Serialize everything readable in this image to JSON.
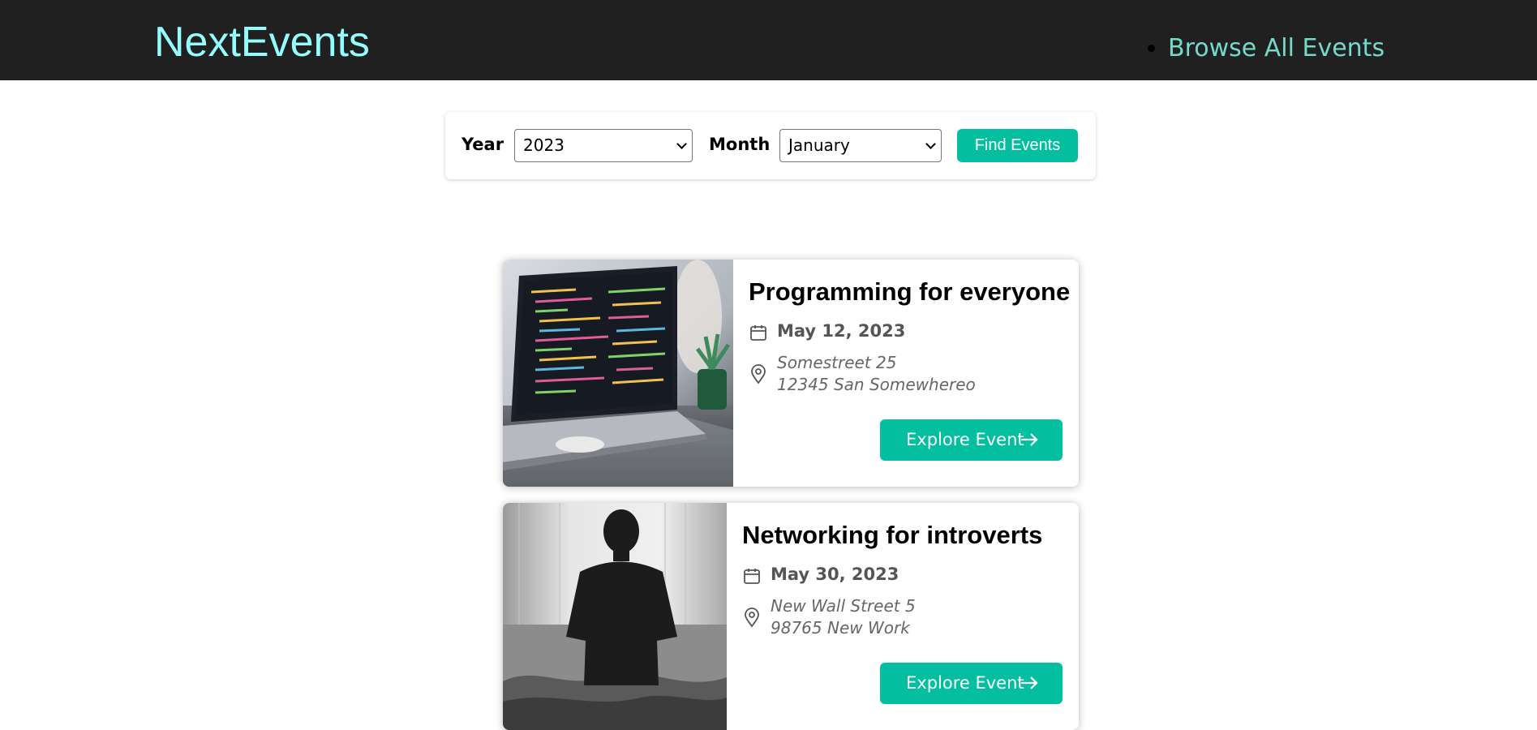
{
  "header": {
    "logo": "NextEvents",
    "nav": [
      {
        "label": "Browse All Events"
      }
    ]
  },
  "filter": {
    "year_label": "Year",
    "year_value": "2023",
    "month_label": "Month",
    "month_value": "January",
    "submit_label": "Find Events"
  },
  "events": [
    {
      "title": "Programming for everyone",
      "date": "May 12, 2023",
      "address_line1": "Somestreet 25",
      "address_line2": "12345 San Somewhereo",
      "button_label": "Explore Event",
      "image": "laptop-code-photo"
    },
    {
      "title": "Networking for introverts",
      "date": "May 30, 2023",
      "address_line1": "New Wall Street 5",
      "address_line2": "98765 New Work",
      "button_label": "Explore Event",
      "image": "person-silhouette-photo"
    }
  ],
  "colors": {
    "header_bg": "#202020",
    "logo": "#94fdfd",
    "nav_link": "#74dacc",
    "accent": "#03be9f"
  }
}
